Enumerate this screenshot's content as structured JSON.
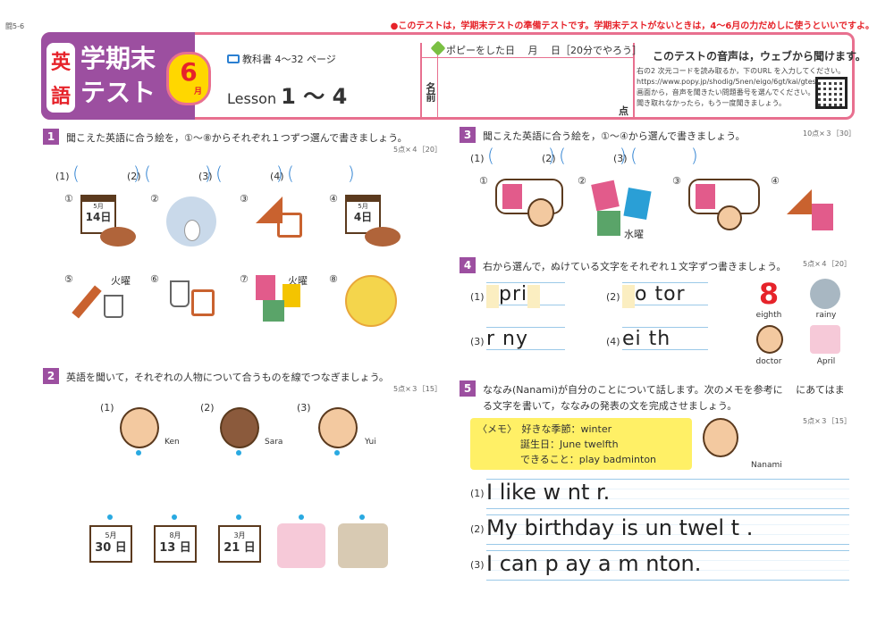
{
  "page_code": "闘5-6",
  "notice": "●このテストは，学期末テストの準備テストです。学期末テストがないときは，4～6月の力だめしに使うといいですよ。",
  "header": {
    "subject_char1": "英",
    "subject_char2": "語",
    "title_line1": "学期末",
    "title_line2": "テスト",
    "month_num": "6",
    "month_label": "月",
    "textbook": "教科書 4～32 ページ",
    "lesson_prefix": "Lesson",
    "lesson_range": "1 ～ 4",
    "poppy": "ポピーをした日　 月 　日［20分でやろう］",
    "name_label": "名前",
    "score_label": "点",
    "web_title": "このテストの音声は，ウェブから聞けます。",
    "web_line1": "右の2 次元コードを読み取るか，下のURL を入力してください。",
    "web_line2": "https://www.popy.jp/shodig/5nen/eigo/6gt/kai/gtest/",
    "web_line3": "画面から，音声を聞きたい問題番号を選んでください。",
    "web_line4": "聞き取れなかったら，もう一度聞きましょう。"
  },
  "q1": {
    "num": "1",
    "text": "聞こえた英語に合う絵を，①～⑧からそれぞれ１つずつ選んで書きましょう。",
    "points": "5点×４［20］",
    "answers": [
      "(1)",
      "(2)",
      "(3)",
      "(4)"
    ],
    "pics": [
      {
        "label": "①",
        "cal_m": "5月",
        "cal_d": "14日"
      },
      {
        "label": "②"
      },
      {
        "label": "③"
      },
      {
        "label": "④",
        "cal_m": "5月",
        "cal_d": "4日"
      },
      {
        "label": "⑤",
        "tag": "火曜"
      },
      {
        "label": "⑥"
      },
      {
        "label": "⑦",
        "tag": "火曜"
      },
      {
        "label": "⑧"
      }
    ]
  },
  "q2": {
    "num": "2",
    "text": "英語を聞いて，それぞれの人物について合うものを線でつなぎましょう。",
    "points": "5点×３［15］",
    "people": [
      {
        "label": "(1)",
        "name": "Ken"
      },
      {
        "label": "(2)",
        "name": "Sara"
      },
      {
        "label": "(3)",
        "name": "Yui"
      }
    ],
    "dates": [
      {
        "m": "5月",
        "d": "30 日"
      },
      {
        "m": "8月",
        "d": "13 日"
      },
      {
        "m": "3月",
        "d": "21 日"
      }
    ]
  },
  "q3": {
    "num": "3",
    "text": "聞こえた英語に合う絵を，①～④から選んで書きましょう。",
    "points": "10点×３［30］",
    "answers": [
      "(1)",
      "(2)",
      "(3)"
    ],
    "pics": [
      {
        "label": "①"
      },
      {
        "label": "②",
        "tag": "水曜"
      },
      {
        "label": "③"
      },
      {
        "label": "④"
      }
    ]
  },
  "q4": {
    "num": "4",
    "text": "右から選んで，ぬけている文字をそれぞれ１文字ずつ書きましょう。",
    "points": "5点×４［20］",
    "items": [
      {
        "label": "(1)",
        "text": "pri"
      },
      {
        "label": "(2)",
        "text": "o tor"
      },
      {
        "label": "(3)",
        "text": "r  ny"
      },
      {
        "label": "(4)",
        "text": "ei  th"
      }
    ],
    "hints": [
      "eighth",
      "rainy",
      "doctor",
      "April"
    ],
    "hint_num": "8"
  },
  "q5": {
    "num": "5",
    "text_line1": "ななみ(Nanami)が自分のことについて話します。次のメモを参考に　 にあてはま",
    "text_line2": "る文字を書いて，ななみの発表の文を完成させましょう。",
    "points": "5点×３［15］",
    "memo_title": "〈メモ〉",
    "memo_rows": [
      "好きな季節：winter",
      "誕生日：June twelfth",
      "できること：play badminton"
    ],
    "person_name": "Nanami",
    "lines": [
      {
        "label": "(1)",
        "text": "I like w nt r."
      },
      {
        "label": "(2)",
        "text": "My birthday is  un  twel t ."
      },
      {
        "label": "(3)",
        "text": "I can p ay  a m nton."
      }
    ]
  },
  "colors": {
    "accent": "#9c4fa0",
    "border": "#e8708f",
    "notice": "#e6232a",
    "paren": "#2a7fd1",
    "blank": "#fbeec1"
  }
}
